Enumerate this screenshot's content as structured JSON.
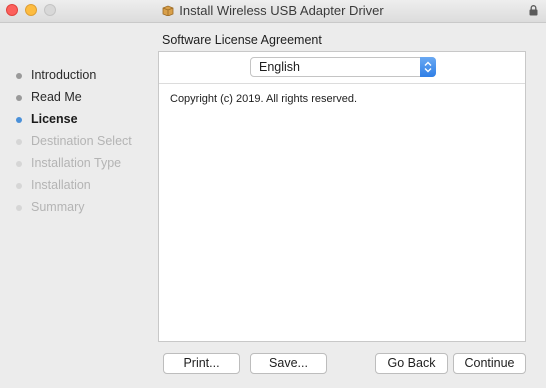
{
  "window": {
    "title": "Install Wireless USB Adapter Driver"
  },
  "sidebar": {
    "steps": [
      {
        "label": "Introduction",
        "state": "done"
      },
      {
        "label": "Read Me",
        "state": "done"
      },
      {
        "label": "License",
        "state": "current"
      },
      {
        "label": "Destination Select",
        "state": "future"
      },
      {
        "label": "Installation Type",
        "state": "future"
      },
      {
        "label": "Installation",
        "state": "future"
      },
      {
        "label": "Summary",
        "state": "future"
      }
    ]
  },
  "main": {
    "pane_title": "Software License Agreement",
    "language_selected": "English",
    "license_text": "Copyright (c) 2019.  All rights reserved."
  },
  "buttons": {
    "print": "Print...",
    "save": "Save...",
    "go_back": "Go Back",
    "continue": "Continue"
  },
  "colors": {
    "current_step_dot": "#4a90d9",
    "close_button": "#fc605c",
    "minimize_button": "#fdbc40"
  }
}
